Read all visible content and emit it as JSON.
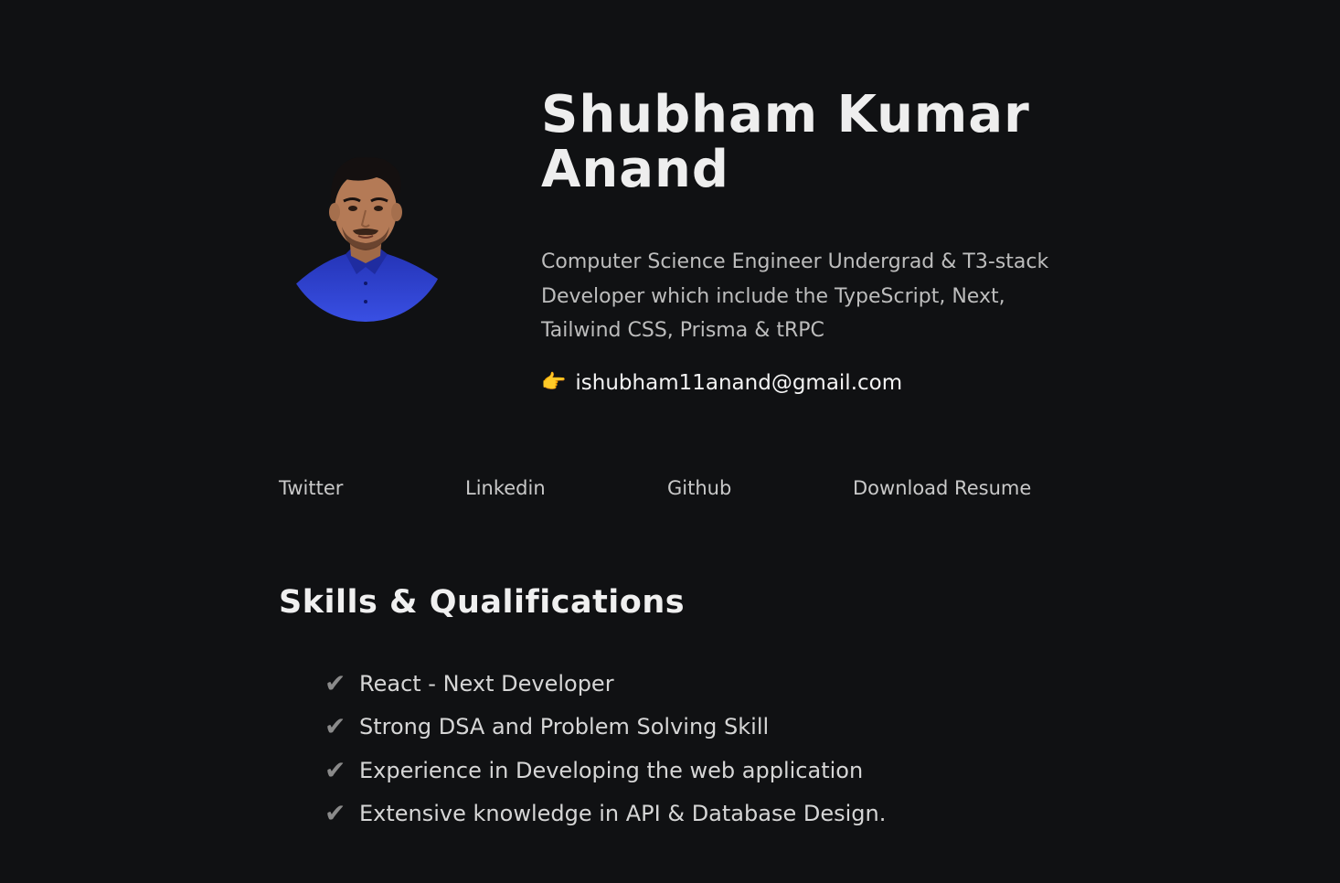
{
  "profile": {
    "name": "Shubham Kumar Anand",
    "bio": "Computer Science Engineer Undergrad & T3-stack Developer which include the TypeScript, Next, Tailwind CSS, Prisma & tRPC",
    "email_icon": "👉",
    "email": "ishubham11anand@gmail.com",
    "avatar_icon": "profile-photo"
  },
  "links": {
    "twitter": "Twitter",
    "linkedin": "Linkedin",
    "github": "Github",
    "resume": "Download Resume"
  },
  "skills": {
    "heading": "Skills & Qualifications",
    "check_icon": "✔",
    "items": [
      "React - Next Developer",
      "Strong DSA and Problem Solving Skill",
      "Experience in Developing the web application",
      "Extensive knowledge in API & Database Design."
    ]
  },
  "colors": {
    "background": "#101113",
    "heading": "#eeeeee",
    "body_text": "#bdbdbd",
    "shirt_blue": "#2f3fd0"
  }
}
